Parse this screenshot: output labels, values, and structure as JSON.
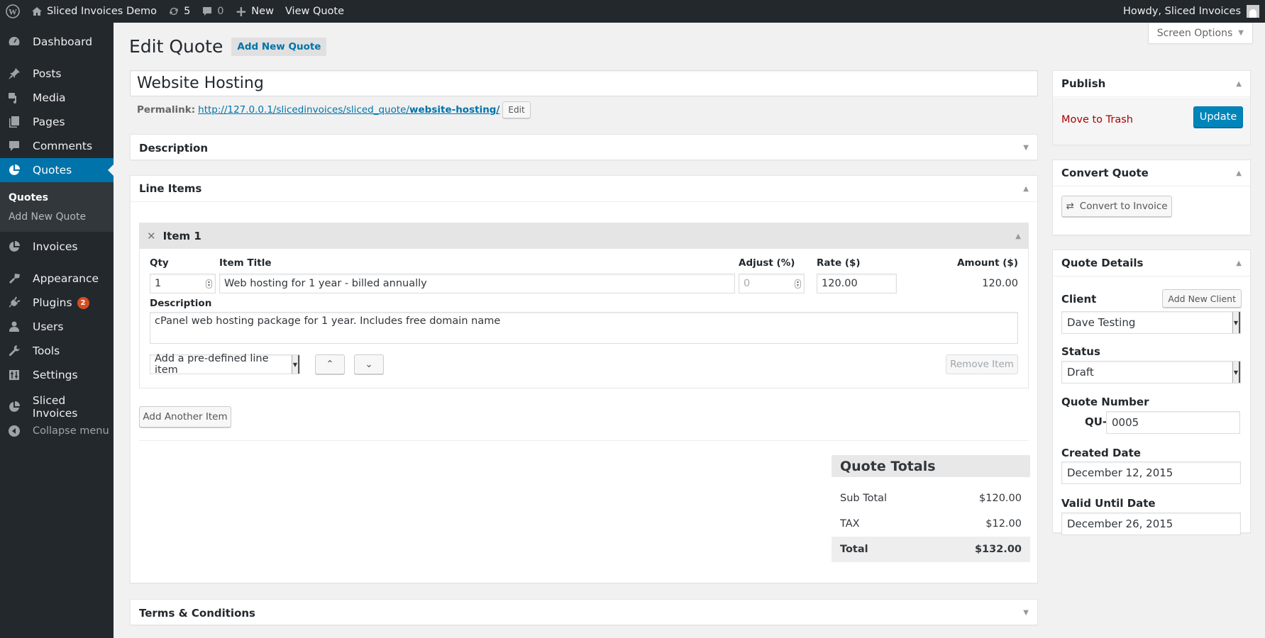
{
  "adminbar": {
    "site_name": "Sliced Invoices Demo",
    "updates_count": "5",
    "comments_count": "0",
    "new_label": "New",
    "view_label": "View Quote",
    "howdy": "Howdy, Sliced Invoices"
  },
  "sidebar": {
    "items": [
      {
        "label": "Dashboard",
        "icon": "dashboard-icon"
      },
      {
        "label": "Posts",
        "icon": "pin-icon"
      },
      {
        "label": "Media",
        "icon": "media-icon"
      },
      {
        "label": "Pages",
        "icon": "pages-icon"
      },
      {
        "label": "Comments",
        "icon": "comment-icon"
      },
      {
        "label": "Quotes",
        "icon": "pie-chart-icon"
      },
      {
        "label": "Invoices",
        "icon": "pie-chart-icon"
      },
      {
        "label": "Appearance",
        "icon": "brush-icon"
      },
      {
        "label": "Plugins",
        "icon": "plug-icon",
        "badge": "2"
      },
      {
        "label": "Users",
        "icon": "user-icon"
      },
      {
        "label": "Tools",
        "icon": "wrench-icon"
      },
      {
        "label": "Settings",
        "icon": "settings-icon"
      },
      {
        "label": "Sliced Invoices",
        "icon": "pie-chart-icon"
      }
    ],
    "submenu": [
      "Quotes",
      "Add New Quote"
    ],
    "collapse": "Collapse menu"
  },
  "screen_options": "Screen Options",
  "page": {
    "title": "Edit Quote",
    "add_new": "Add New Quote",
    "post_title": "Website Hosting",
    "permalink_label": "Permalink:",
    "permalink_base": "http://127.0.0.1/slicedinvoices/sliced_quote/",
    "permalink_slug": "website-hosting/",
    "permalink_edit": "Edit"
  },
  "boxes": {
    "description": "Description",
    "line_items": "Line Items",
    "terms": "Terms & Conditions"
  },
  "line_item": {
    "title": "Item 1",
    "labels": {
      "qty": "Qty",
      "item_title": "Item Title",
      "adjust": "Adjust (%)",
      "rate": "Rate ($)",
      "amount": "Amount ($)",
      "description": "Description"
    },
    "qty": "1",
    "item_title": "Web hosting for 1 year - billed annually",
    "adjust": "0",
    "rate": "120.00",
    "amount": "120.00",
    "description": "cPanel web hosting package for 1 year. Includes free domain name",
    "predefined": "Add a pre-defined line item",
    "remove": "Remove Item"
  },
  "add_another": "Add Another Item",
  "totals": {
    "title": "Quote Totals",
    "rows": [
      {
        "label": "Sub Total",
        "value": "$120.00"
      },
      {
        "label": "TAX",
        "value": "$12.00"
      },
      {
        "label": "Total",
        "value": "$132.00"
      }
    ]
  },
  "publish": {
    "title": "Publish",
    "trash": "Move to Trash",
    "update": "Update"
  },
  "convert": {
    "title": "Convert Quote",
    "button": "Convert to Invoice"
  },
  "details": {
    "title": "Quote Details",
    "client_label": "Client",
    "add_client": "Add New Client",
    "client": "Dave Testing",
    "status_label": "Status",
    "status": "Draft",
    "number_label": "Quote Number",
    "prefix": "QU-",
    "number": "0005",
    "created_label": "Created Date",
    "created": "December 12, 2015",
    "valid_label": "Valid Until Date",
    "valid": "December 26, 2015"
  },
  "colors": {
    "accent": "#0073aa",
    "adminbar": "#23282d",
    "trash": "#a00",
    "badge": "#d54e21"
  }
}
